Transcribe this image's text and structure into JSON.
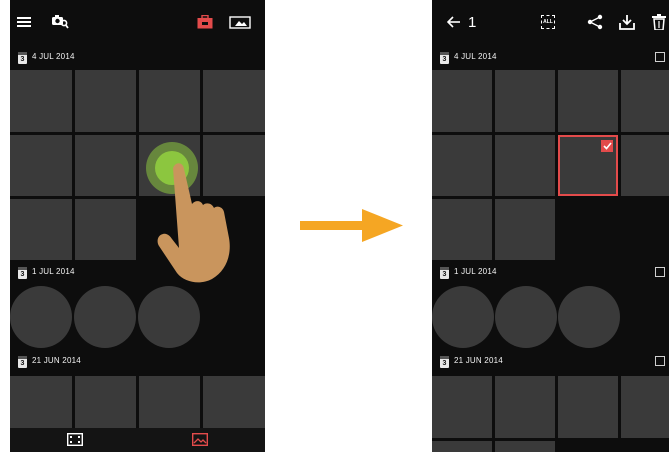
{
  "left_screen": {
    "toolbar": {
      "menu_icon": "hamburger-menu-icon",
      "camera_search_icon": "camera-search-icon",
      "toolbox_icon": "toolbox-icon",
      "photo_view_icon": "image-frame-icon"
    },
    "sections": [
      {
        "calendar_day": "3",
        "date": "4 JUL 2014"
      },
      {
        "calendar_day": "3",
        "date": "1 JUL 2014"
      },
      {
        "calendar_day": "3",
        "date": "21 JUN 2014"
      }
    ],
    "bottom_bar": {
      "film_icon": "film-icon",
      "gallery_icon": "gallery-icon"
    },
    "gesture": "long-press"
  },
  "right_screen": {
    "toolbar": {
      "back_icon": "back-arrow-icon",
      "selected_count": "1",
      "select_all_label": "ALL",
      "share_icon": "share-icon",
      "download_icon": "download-icon",
      "delete_icon": "trash-icon"
    },
    "sections": [
      {
        "calendar_day": "3",
        "date": "4 JUL 2014"
      },
      {
        "calendar_day": "3",
        "date": "1 JUL 2014"
      },
      {
        "calendar_day": "3",
        "date": "21 JUN 2014"
      }
    ]
  },
  "colors": {
    "accent_red": "#e34b4b",
    "press_green": "#8cc63f",
    "arrow_orange": "#f5a623",
    "tile_gray": "#3a3a3a",
    "background": "#0d0d0d"
  }
}
